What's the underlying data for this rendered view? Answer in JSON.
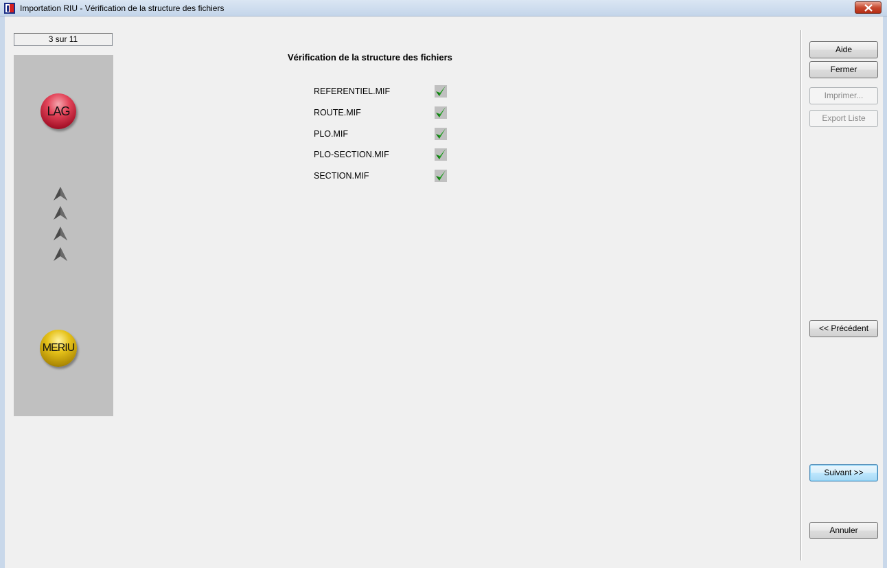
{
  "window": {
    "title": "Importation RIU - Vérification de la structure des fichiers"
  },
  "step_counter": "3 sur 11",
  "left_panel": {
    "top_logo_label": "LAG",
    "bottom_logo_label": "MERIU",
    "arrow_icons": [
      "arrow-up-icon",
      "arrow-up-icon",
      "arrow-up-icon",
      "arrow-up-icon"
    ]
  },
  "main": {
    "heading": "Vérification de la structure des fichiers",
    "files": [
      {
        "name": "REFERENTIEL.MIF",
        "status": "ok"
      },
      {
        "name": "ROUTE.MIF",
        "status": "ok"
      },
      {
        "name": "PLO.MIF",
        "status": "ok"
      },
      {
        "name": "PLO-SECTION.MIF",
        "status": "ok"
      },
      {
        "name": "SECTION.MIF",
        "status": "ok"
      }
    ]
  },
  "buttons": {
    "help": "Aide",
    "close": "Fermer",
    "print": "Imprimer...",
    "export": "Export Liste",
    "previous": "<< Précédent",
    "next": "Suivant >>",
    "cancel": "Annuler"
  },
  "colors": {
    "check": "#1a9a1a",
    "lag_orb": "#d42a40",
    "meriu_orb": "#d4b010",
    "panel": "#c0c0c0"
  }
}
